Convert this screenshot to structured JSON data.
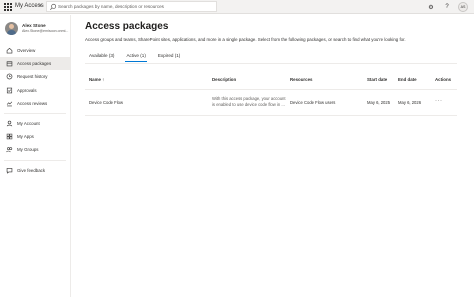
{
  "header": {
    "app_title": "My Access",
    "search_placeholder": "Search packages by name, description or resources",
    "help_label": "?",
    "user_initials": "AS"
  },
  "sidebar": {
    "user_name": "Alex Stone",
    "user_email": "Alex.Stone@emisoon.onmi...",
    "items": [
      {
        "label": "Overview",
        "icon": "home-icon"
      },
      {
        "label": "Access packages",
        "icon": "package-icon",
        "active": true
      },
      {
        "label": "Request history",
        "icon": "history-icon"
      },
      {
        "label": "Approvals",
        "icon": "approvals-icon"
      },
      {
        "label": "Access reviews",
        "icon": "reviews-icon"
      },
      {
        "label": "My Account",
        "icon": "account-icon"
      },
      {
        "label": "My Apps",
        "icon": "apps-icon"
      },
      {
        "label": "My Groups",
        "icon": "groups-icon"
      },
      {
        "label": "Give feedback",
        "icon": "feedback-icon"
      }
    ]
  },
  "main": {
    "title": "Access packages",
    "subtitle": "Access groups and teams, SharePoint sites, applications, and more in a single package. Select from the following packages, or search to find what you're looking for.",
    "tabs": [
      {
        "label": "Available (3)"
      },
      {
        "label": "Active (1)",
        "active": true
      },
      {
        "label": "Expired (1)"
      }
    ],
    "table": {
      "columns": {
        "name": "Name ↑",
        "description": "Description",
        "resources": "Resources",
        "start_date": "Start date",
        "end_date": "End date",
        "actions": "Actions"
      },
      "rows": [
        {
          "name": "Device Code Flow",
          "description": "With this access package, your account is enabled to use device code flow in ...",
          "resources": "Device Code Flow users",
          "start_date": "May 6, 2025",
          "end_date": "May 6, 2026",
          "actions": "···"
        }
      ]
    }
  },
  "colors": {
    "accent": "#0078d4",
    "topbar_bg": "#f3f2f1",
    "active_nav_bg": "#edebe9"
  }
}
